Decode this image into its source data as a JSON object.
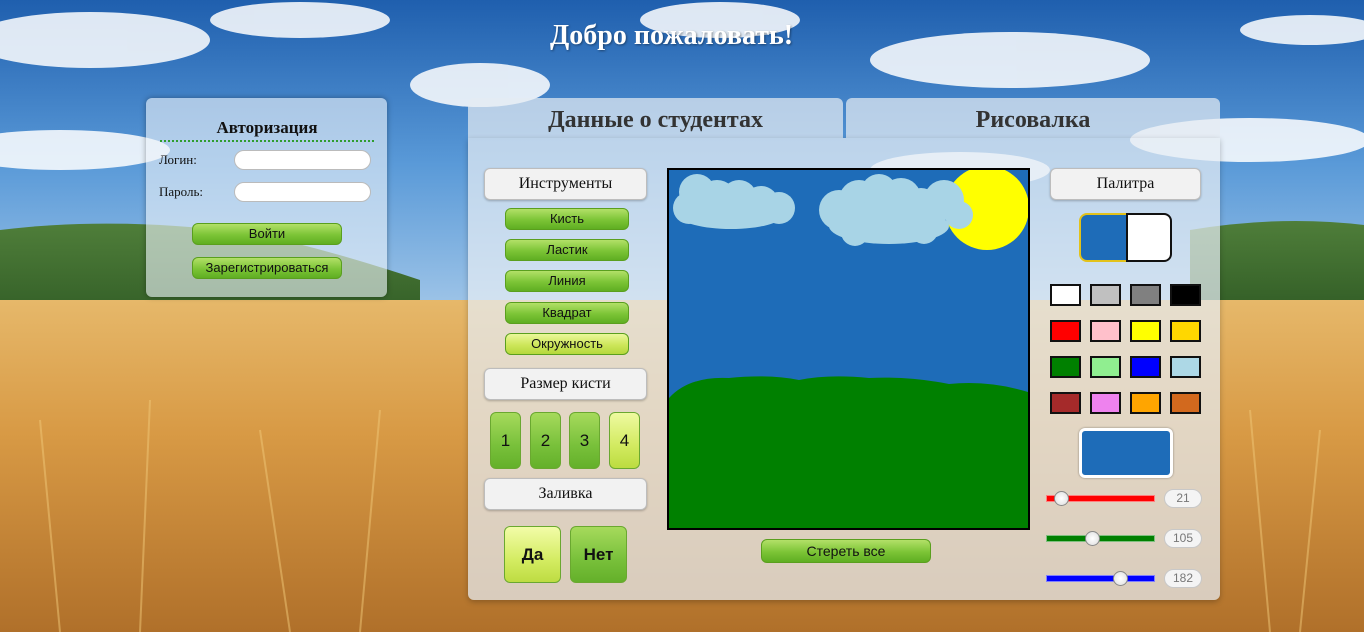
{
  "header": {
    "welcome": "Добро пожаловать!"
  },
  "auth": {
    "title": "Авторизация",
    "login_label": "Логин:",
    "login_value": "",
    "password_label": "Пароль:",
    "password_value": "",
    "login_button": "Войти",
    "register_button": "Зарегистрироваться"
  },
  "tabs": [
    {
      "label": "Данные о студентах"
    },
    {
      "label": "Рисовалка"
    }
  ],
  "tools": {
    "header": "Инструменты",
    "items": [
      {
        "label": "Кисть"
      },
      {
        "label": "Ластик"
      },
      {
        "label": "Линия"
      },
      {
        "label": "Квадрат"
      },
      {
        "label": "Окружность"
      }
    ],
    "selected": "Окружность"
  },
  "brush": {
    "header": "Размер кисти",
    "sizes": [
      "1",
      "2",
      "3",
      "4"
    ],
    "selected": "4"
  },
  "fill": {
    "header": "Заливка",
    "yes_label": "Да",
    "no_label": "Нет",
    "selected": "Да"
  },
  "canvas": {
    "clear_button": "Стереть все"
  },
  "palette": {
    "header": "Палитра",
    "primary_color": "#1e6cb8",
    "secondary_color": "#ffffff",
    "swatches": [
      "#ffffff",
      "#c0c0c0",
      "#808080",
      "#000000",
      "#ff0000",
      "#ffc0cb",
      "#ffff00",
      "#ffd700",
      "#008000",
      "#90ee90",
      "#0000ff",
      "#add8e6",
      "#a52a2a",
      "#ee82ee",
      "#ffa500",
      "#d2691e"
    ],
    "preview_color": "#1e6cb8",
    "sliders": [
      {
        "channel": "red",
        "color": "#ff0000",
        "value": 21
      },
      {
        "channel": "green",
        "color": "#008000",
        "value": 105
      },
      {
        "channel": "blue",
        "color": "#0000ff",
        "value": 182
      }
    ]
  }
}
